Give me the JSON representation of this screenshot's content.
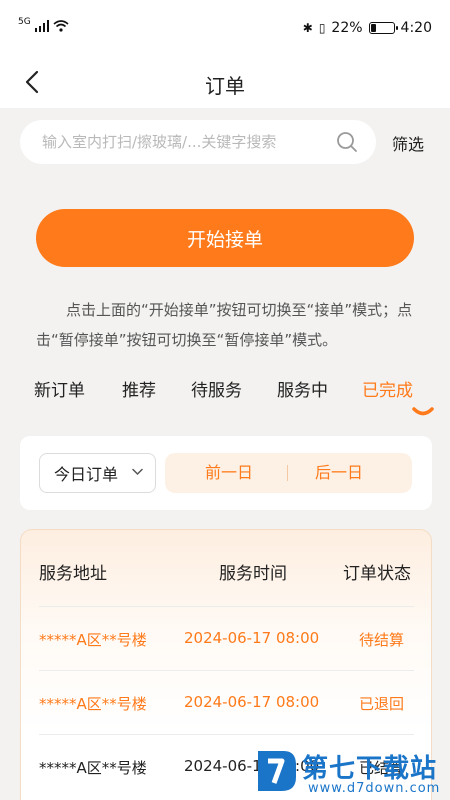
{
  "status_bar": {
    "network": "5G",
    "battery": "22%",
    "battery_level": 0.22,
    "time": "4:20"
  },
  "header": {
    "title": "订单"
  },
  "search": {
    "placeholder": "输入室内打扫/擦玻璃/...关键字搜索",
    "filter_label": "筛选"
  },
  "start_button": {
    "label": "开始接单"
  },
  "tip": "点击上面的“开始接单”按钮可切换至“接单”模式；点击“暂停接单”按钮可切换至“暂停接单”模式。",
  "tabs": [
    {
      "label": "新订单",
      "active": false
    },
    {
      "label": "推荐",
      "active": false
    },
    {
      "label": "待服务",
      "active": false
    },
    {
      "label": "服务中",
      "active": false
    },
    {
      "label": "已完成",
      "active": true
    }
  ],
  "date_filter": {
    "selected": "今日订单",
    "prev_label": "前一日",
    "next_label": "后一日"
  },
  "table": {
    "headers": [
      "服务地址",
      "服务时间",
      "订单状态"
    ],
    "rows": [
      {
        "address": "*****A区**号楼",
        "time": "2024-06-17 08:00",
        "status": "待结算",
        "highlight": true
      },
      {
        "address": "*****A区**号楼",
        "time": "2024-06-17 08:00",
        "status": "已退回",
        "highlight": true
      },
      {
        "address": "*****A区**号楼",
        "time": "2024-06-17 08:00",
        "status": "已结算",
        "highlight": false
      }
    ]
  },
  "watermark": {
    "text": "第七下载站",
    "url": "www.d7down.com"
  },
  "colors": {
    "accent": "#ff7a1a",
    "background": "#f3f2f1",
    "watermark": "#1a75c9"
  }
}
